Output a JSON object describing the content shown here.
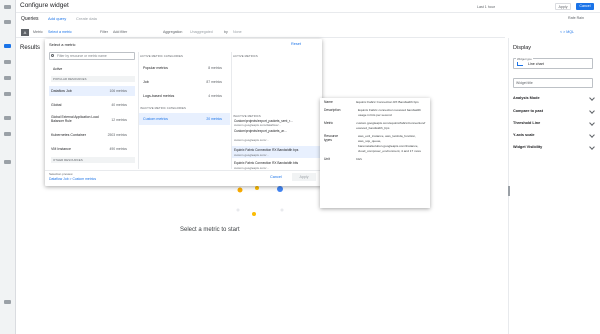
{
  "app": {
    "title": "Configure widget"
  },
  "topbar": {
    "time_range": "Last 1 hour",
    "apply_label": "Apply",
    "cancel_label": "Cancel",
    "user": "Rafe Rain"
  },
  "queries": {
    "title": "Queries",
    "add_query": "Add query",
    "create_data": "Create data",
    "metric_label": "Metric",
    "select_metric": "Select a metric",
    "filter_label": "Filter",
    "filter_value": "Add filter",
    "aggregation_label": "Aggregation",
    "aggregation_value": "Unaggregated",
    "by_label": "by",
    "none_value": "None",
    "mql_label": "< > MQL"
  },
  "results_label": "Results",
  "placeholder": "Select a metric to start",
  "picker": {
    "title": "Select a metric",
    "reset": "Reset",
    "search_placeholder": "Filter by resource or metric name",
    "active_label": "Active",
    "popular_resources_header": "POPULAR RESOURCES",
    "resources": [
      {
        "name": "Dataflow Job",
        "count": "106 metrics"
      },
      {
        "name": "Global",
        "count": "40 metrics"
      },
      {
        "name": "Global External Application Load Balancer Rule",
        "count": "12 metrics"
      },
      {
        "name": "Kubernetes Container",
        "count": "2503 metrics"
      },
      {
        "name": "VM Instance",
        "count": "490 metrics"
      }
    ],
    "other_resources_header": "OTHER RESOURCES",
    "cat_header": "ACTIVE METRIC CATEGORIES",
    "categories": [
      {
        "name": "Popular metrics",
        "count": "8 metrics"
      },
      {
        "name": "Job",
        "count": "87 metrics"
      },
      {
        "name": "Logs-based metrics",
        "count": "4 metrics"
      }
    ],
    "inactive_cat_header": "INACTIVE METRIC CATEGORIES",
    "active_category": {
      "name": "Custom metrics",
      "count": "20 metrics"
    },
    "metrics_header": "ACTIVE METRICS",
    "inactive_metrics_header": "INACTIVE METRICS",
    "metrics": [
      {
        "name": "Custom/projects/export_packets_sent_r...",
        "sub": "custom.googleapis.com/dataflow/..."
      },
      {
        "name": "Equinix Fabric Connection RX Bandwidth...",
        "sub": "custom.googleapis.com/..."
      },
      {
        "name": "Custom/projects/export_packets_ar...",
        "sub": "custom.googleapis.com/..."
      },
      {
        "name": "Equinix Fabric Connection RX Bandwidth bps",
        "sub": "custom.googleapis.com/..."
      },
      {
        "name": "Equinix Fabric Connection RX Bandwidth bits",
        "sub": "custom.googleapis.com/..."
      }
    ],
    "selection_label": "Selection preview",
    "selection_value": "Dataflow Job > Custom metrics",
    "cancel": "Cancel",
    "apply": "Apply"
  },
  "detail": {
    "name_key": "Name",
    "name_val": "Equinix Fabric Connection RX Bandwidth bps",
    "desc_key": "Description",
    "desc_val": "Equinix Fabric connection received bandwidth usage in bits per second",
    "metric_key": "Metric",
    "metric_val": "custom.googleapis.com/equinix/fabric/connection/received_bandwidth_bps",
    "labels_key": "Resource types",
    "labels_val": "aws_ec2_instance, aws_lambda_function, aws_sqs_queue, baremetalsolution.googleapis.com/Instance, cloud_composer_environment, 4 and 17 more",
    "unit_key": "Unit",
    "unit_val": "bit/s"
  },
  "display": {
    "title": "Display",
    "widget_type_label": "Widget type",
    "widget_type_value": "Line chart",
    "widget_title_label": "Widget title",
    "rows": [
      "Analysis Mode",
      "Compare to past",
      "Threshold Line",
      "Y-axis scale",
      "Widget Visibility"
    ]
  }
}
